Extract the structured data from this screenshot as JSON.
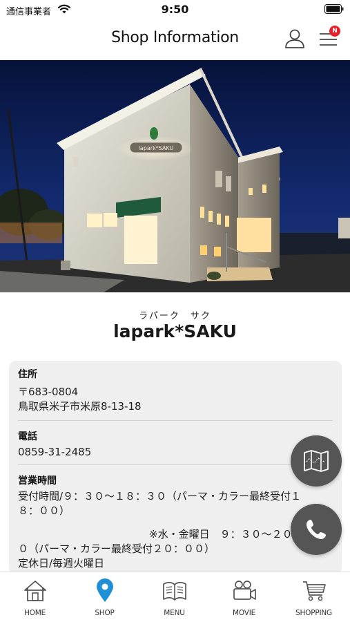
{
  "status_bar": {
    "carrier": "通信事業者",
    "time": "9:50"
  },
  "header": {
    "title": "Shop Information",
    "notification_badge": "N"
  },
  "shop": {
    "name_kana": "ラパーク　サク",
    "name": "lapark*SAKU",
    "hero_sign": "lapark*SAKU"
  },
  "info": {
    "address_label": "住所",
    "postal_code": "〒683-0804",
    "address": "鳥取県米子市米原8-13-18",
    "phone_label": "電話",
    "phone": "0859-31-2485",
    "hours_label": "営業時間",
    "hours_line1": "受付時間/９：３０〜１８：３０（パーマ・カラー最終受付１",
    "hours_line2": "８：００）",
    "hours_line3": "※水・金曜日　９：３０〜２０：０",
    "hours_line4": "０（パーマ・カラー最終受付２０：００）",
    "hours_line5": "定休日/毎週火曜日"
  },
  "fab": {
    "map_icon": "map-icon",
    "call_icon": "phone-icon"
  },
  "tabs": [
    {
      "label": "HOME",
      "icon": "home-icon"
    },
    {
      "label": "SHOP",
      "icon": "map-pin-icon",
      "active": true
    },
    {
      "label": "MENU",
      "icon": "book-icon"
    },
    {
      "label": "MOVIE",
      "icon": "video-camera-icon"
    },
    {
      "label": "SHOPPING",
      "icon": "cart-icon"
    }
  ],
  "colors": {
    "accent": "#1f8fd6",
    "fab": "#555555",
    "card_bg": "#efefef",
    "badge": "#e8202a"
  }
}
